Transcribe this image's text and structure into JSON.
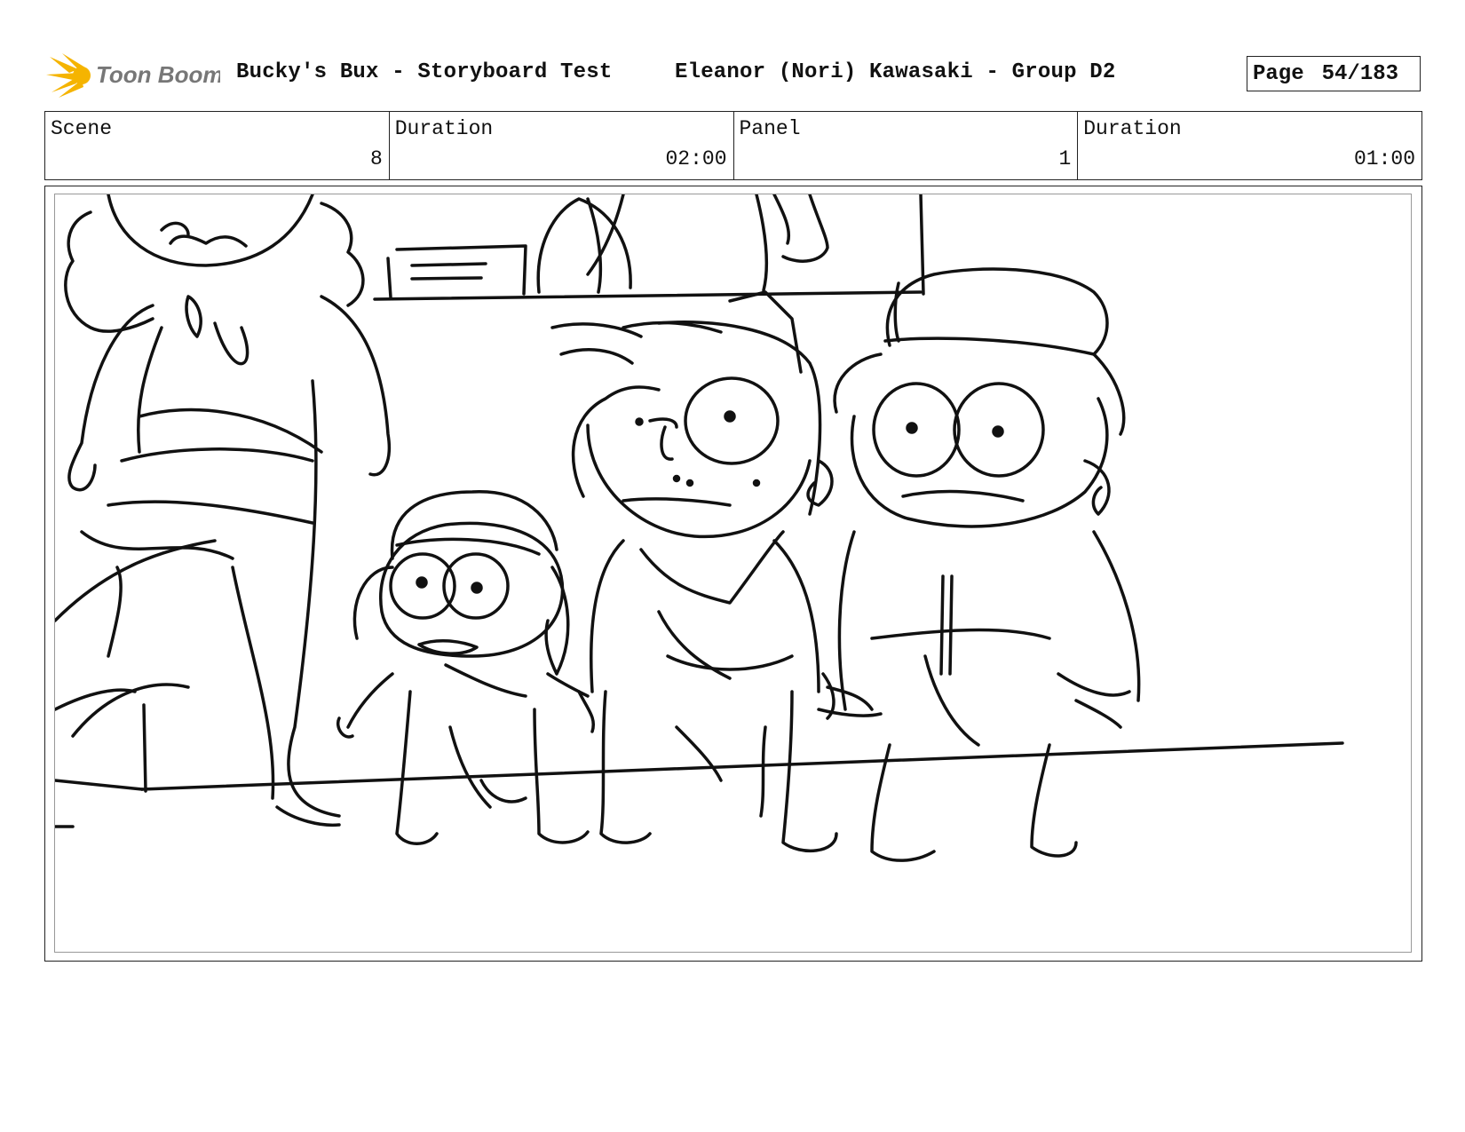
{
  "header": {
    "logo_text": "Toon Boom",
    "project_title": "Bucky's Bux - Storyboard Test",
    "author": "Eleanor (Nori) Kawasaki - Group D2",
    "page_label": "Page",
    "page_number": "54/183"
  },
  "info": {
    "scene_label": "Scene",
    "scene_value": "8",
    "scene_duration_label": "Duration",
    "scene_duration_value": "02:00",
    "panel_label": "Panel",
    "panel_value": "1",
    "panel_duration_label": "Duration",
    "panel_duration_value": "01:00"
  },
  "colors": {
    "logo_accent": "#f5b400",
    "logo_text": "#777777",
    "line": "#111111"
  }
}
